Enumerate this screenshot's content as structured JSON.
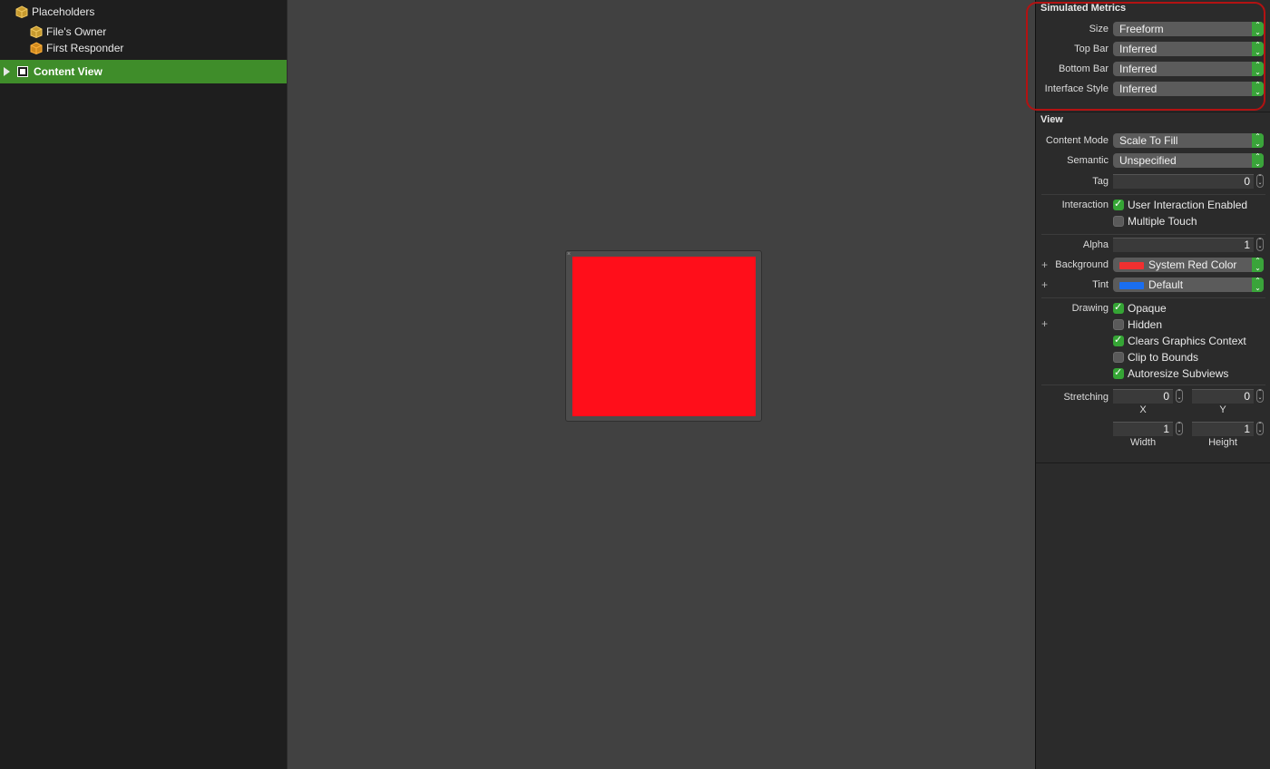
{
  "navigator": {
    "placeholders_label": "Placeholders",
    "files_owner_label": "File's Owner",
    "first_responder_label": "First Responder",
    "content_view_label": "Content View"
  },
  "canvas": {
    "view_background_color": "#ff0e1a"
  },
  "inspector": {
    "simulated_metrics": {
      "title": "Simulated Metrics",
      "size_label": "Size",
      "size_value": "Freeform",
      "top_bar_label": "Top Bar",
      "top_bar_value": "Inferred",
      "bottom_bar_label": "Bottom Bar",
      "bottom_bar_value": "Inferred",
      "interface_style_label": "Interface Style",
      "interface_style_value": "Inferred"
    },
    "view": {
      "title": "View",
      "content_mode_label": "Content Mode",
      "content_mode_value": "Scale To Fill",
      "semantic_label": "Semantic",
      "semantic_value": "Unspecified",
      "tag_label": "Tag",
      "tag_value": "0",
      "interaction_label": "Interaction",
      "user_interaction_label": "User Interaction Enabled",
      "multiple_touch_label": "Multiple Touch",
      "alpha_label": "Alpha",
      "alpha_value": "1",
      "background_label": "Background",
      "background_value": "System Red Color",
      "tint_label": "Tint",
      "tint_value": "Default",
      "drawing_label": "Drawing",
      "opaque_label": "Opaque",
      "hidden_label": "Hidden",
      "clears_graphics_label": "Clears Graphics Context",
      "clip_bounds_label": "Clip to Bounds",
      "autoresize_label": "Autoresize Subviews",
      "stretching_label": "Stretching",
      "stretch_x_value": "0",
      "stretch_x_label": "X",
      "stretch_y_value": "0",
      "stretch_y_label": "Y",
      "stretch_width_value": "1",
      "stretch_width_label": "Width",
      "stretch_height_value": "1",
      "stretch_height_label": "Height"
    },
    "colors": {
      "red": "#f03030",
      "blue": "#1a6ef0",
      "accent_green": "#3aa43a",
      "selection_green": "#3f8d2a"
    }
  }
}
